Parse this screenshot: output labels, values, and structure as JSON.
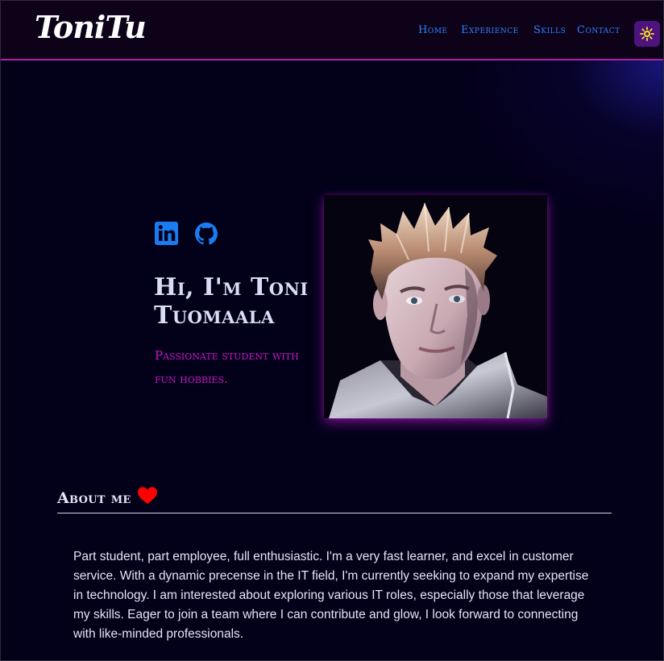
{
  "nav": {
    "logo": "ToniTu",
    "links": [
      "Home",
      "Experience",
      "Skills",
      "Contact"
    ],
    "theme_icon": "sun-icon"
  },
  "hero": {
    "social_icons": [
      "linkedin-icon",
      "github-icon"
    ],
    "title": "Hi, I'm Toni Tuomaala",
    "subtitle": "Passionate student with fun hobbies."
  },
  "about": {
    "heading": "About me",
    "heading_icon": "heart-icon",
    "text": "Part student, part employee, full enthusiastic. I'm a very fast learner, and excel in customer service. With a dynamic precense in the IT field, I'm currently seeking to expand my expertise in technology. I am interested about exploring various IT roles, especially those that leverage my skills. Eager to join a team where I can contribute and glow, I look forward to connecting with like-minded professionals."
  },
  "colors": {
    "background": "#03001a",
    "accent": "#c917c4",
    "link": "#2e80ff",
    "nav_border": "#b41fa8",
    "heart": "#ff0000"
  }
}
